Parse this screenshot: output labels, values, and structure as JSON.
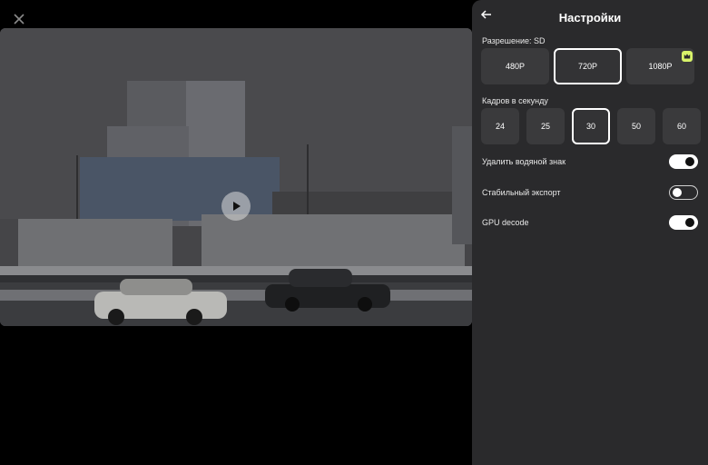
{
  "panel": {
    "title": "Настройки",
    "resolution": {
      "label": "Разрешение: SD",
      "options": [
        "480P",
        "720P",
        "1080P"
      ],
      "selected": "720P"
    },
    "fps": {
      "label": "Кадров в секунду",
      "options": [
        "24",
        "25",
        "30",
        "50",
        "60"
      ],
      "selected": "30"
    },
    "toggles": [
      {
        "label": "Удалить водяной знак",
        "state": "on"
      },
      {
        "label": "Стабильный экспорт",
        "state": "off"
      },
      {
        "label": "GPU decode",
        "state": "on"
      }
    ]
  },
  "colors": {
    "panel_bg": "#2a2a2c",
    "button_bg": "#3a3a3c",
    "pro_badge": "#d8f36a"
  },
  "icons": {
    "close": "close-icon",
    "back": "back-arrow-icon",
    "play": "play-icon",
    "pro": "crown-icon"
  }
}
